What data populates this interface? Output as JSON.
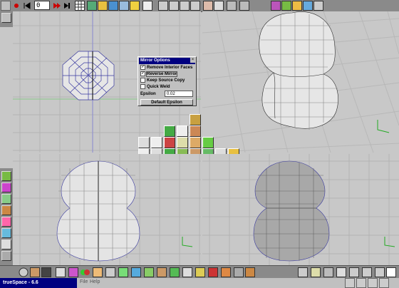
{
  "app": {
    "title": "trueSpace - 6.6",
    "menu": [
      "File",
      "Help"
    ],
    "frame": "0"
  },
  "mirror_panel": {
    "title": "Mirror Options",
    "close": "×",
    "options": [
      {
        "label": "Remove Interior Faces",
        "checked": true
      },
      {
        "label": "Reverse Mirror",
        "checked": true
      },
      {
        "label": "Keep Source Copy",
        "checked": false
      },
      {
        "label": "Quick Weld",
        "checked": false
      }
    ],
    "epsilon_label": "Epsilon",
    "epsilon_value": "0.02",
    "default_button": "Default Epsilon"
  },
  "viewports": [
    {
      "name": "top-left",
      "view": "top"
    },
    {
      "name": "perspective",
      "view": "perspective"
    },
    {
      "name": "front",
      "view": "front"
    },
    {
      "name": "right",
      "view": "right"
    }
  ],
  "colors": {
    "viewport_bg": "#c8c8c8",
    "grid": "#b0b0b0",
    "toolbar": "#8a8a8a",
    "title_blue": "#000080",
    "wire": "#3a3aa0"
  },
  "toolbar_icons": [
    "stop-icon",
    "record-icon",
    "rewind-icon",
    "prev-frame-icon",
    "play-icon",
    "next-frame-icon",
    "end-icon",
    "grid-icon",
    "object-icon",
    "paint-icon",
    "render-icon",
    "camera-icon",
    "light-icon",
    "view-icon"
  ],
  "bottom_icons": [
    "sphere-icon",
    "cube-icon",
    "material-icon",
    "deform-icon",
    "anim-icon",
    "light-icon",
    "camera-icon",
    "render-icon",
    "paint-icon",
    "scene-icon",
    "figure-icon",
    "help-icon"
  ]
}
